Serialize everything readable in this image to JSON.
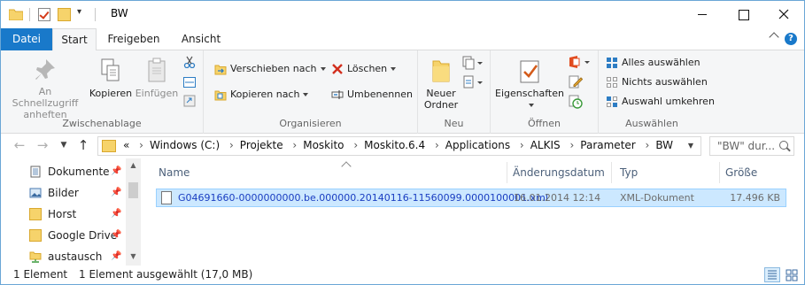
{
  "window": {
    "title": "BW",
    "quick_access_dropdown": "▾"
  },
  "tabs": [
    {
      "label": "Datei"
    },
    {
      "label": "Start"
    },
    {
      "label": "Freigeben"
    },
    {
      "label": "Ansicht"
    }
  ],
  "ribbon": {
    "clipboard": {
      "pin_label": "An Schnellzugriff anheften",
      "copy_label": "Kopieren",
      "paste_label": "Einfügen",
      "group_label": "Zwischenablage"
    },
    "organize": {
      "move_label": "Verschieben nach",
      "copy_to_label": "Kopieren nach",
      "delete_label": "Löschen",
      "rename_label": "Umbenennen",
      "group_label": "Organisieren"
    },
    "new": {
      "new_folder_label": "Neuer Ordner",
      "group_label": "Neu"
    },
    "open": {
      "properties_label": "Eigenschaften",
      "group_label": "Öffnen"
    },
    "select": {
      "select_all_label": "Alles auswählen",
      "select_none_label": "Nichts auswählen",
      "invert_label": "Auswahl umkehren",
      "group_label": "Auswählen"
    }
  },
  "address": {
    "prefix": "«",
    "crumbs": [
      "Windows (C:)",
      "Projekte",
      "Moskito",
      "Moskito.6.4",
      "Applications",
      "ALKIS",
      "Parameter",
      "BW"
    ],
    "search_placeholder": "\"BW\" dur..."
  },
  "nav_pane": {
    "items": [
      {
        "label": "Dokumente",
        "icon": "documents-icon",
        "pinned": true
      },
      {
        "label": "Bilder",
        "icon": "pictures-icon",
        "pinned": true
      },
      {
        "label": "Horst",
        "icon": "folder-icon",
        "pinned": true
      },
      {
        "label": "Google Drive",
        "icon": "folder-icon",
        "pinned": true
      },
      {
        "label": "austausch",
        "icon": "network-folder-icon",
        "pinned": true
      }
    ]
  },
  "file_list": {
    "columns": [
      "Name",
      "Änderungsdatum",
      "Typ",
      "Größe"
    ],
    "rows": [
      {
        "name": "G04691660-0000000000.be.000000.20140116-11560099.0000100001.xml",
        "date": "16.01.2014 12:14",
        "type": "XML-Dokument",
        "size": "17.496 KB",
        "selected": true
      }
    ]
  },
  "status": {
    "count": "1 Element",
    "selection": "1 Element ausgewählt (17,0 MB)"
  },
  "colors": {
    "accent": "#1979ca",
    "selection_bg": "#cce8ff",
    "selection_border": "#99d1ff",
    "link_text": "#1a3dc1"
  }
}
